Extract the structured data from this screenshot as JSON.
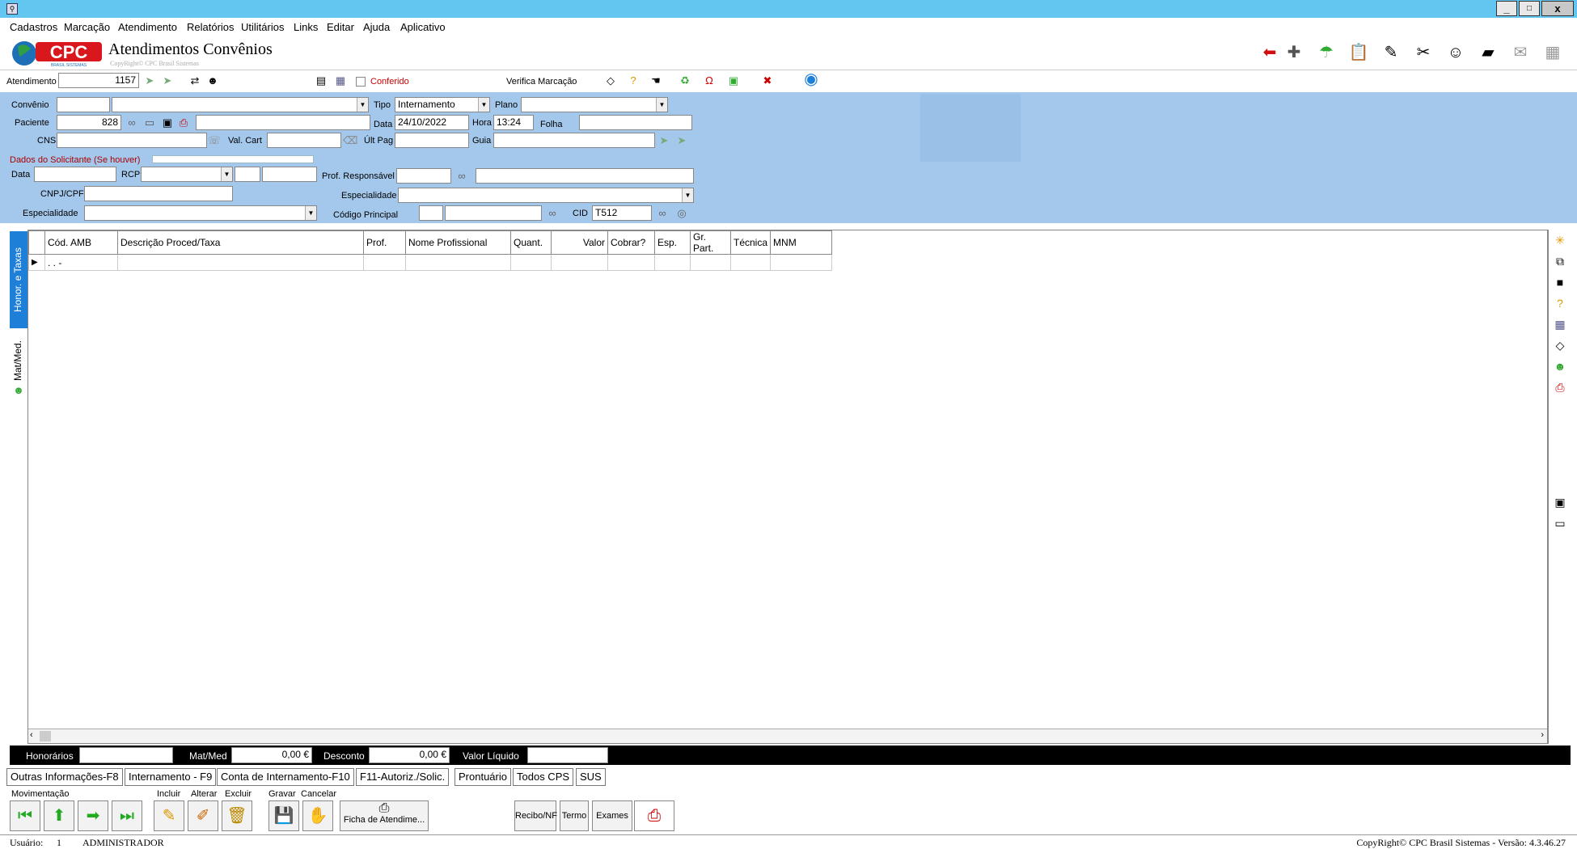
{
  "window": {
    "min": "_",
    "max": "□",
    "close": "x"
  },
  "menu": [
    "Cadastros",
    "Marcação",
    "Atendimento",
    "Relatórios",
    "Utilitários",
    "Links",
    "Editar",
    "Ajuda",
    "Aplicativo"
  ],
  "header": {
    "logo": "CPC",
    "logo_sub": "BRASIL SISTEMAS",
    "title": "Atendimentos Convênios",
    "copyright_small": "CopyRight© CPC Brasil Sistemas"
  },
  "atendimento": {
    "label": "Atendimento",
    "value": "1157",
    "conferido_label": "Conferido",
    "verifica_label": "Verifica Marcação"
  },
  "form": {
    "convenio_label": "Convênio",
    "convenio_code": "",
    "convenio_name": "",
    "tipo_label": "Tipo",
    "tipo_value": "Internamento",
    "plano_label": "Plano",
    "plano_value": "",
    "paciente_label": "Paciente",
    "paciente_code": "828",
    "paciente_name": "",
    "data_label": "Data",
    "data_value": "24/10/2022",
    "hora_label": "Hora",
    "hora_value": "13:24",
    "folha_label": "Folha",
    "folha_value": "",
    "cns_label": "CNS",
    "cns_value": "",
    "valcart_label": "Val. Cart",
    "valcart_value": "",
    "ultpag_label": "Últ Pag",
    "ultpag_value": "",
    "guia_label": "Guia",
    "guia_value": "",
    "solicitante_label": "Dados do Solicitante (Se houver)",
    "sdata_label": "Data",
    "rcp_label": "RCP",
    "cnpj_label": "CNPJ/CPF",
    "esp_label": "Especialidade",
    "profresp_label": "Prof. Responsável",
    "esp2_label": "Especialidade",
    "codprinc_label": "Código Principal",
    "cid_label": "CID",
    "cid_value": "T512"
  },
  "side_tabs": {
    "honor": "Honor. e Taxas",
    "matmed": "Mat/Med."
  },
  "grid": {
    "columns": [
      "",
      "Cód. AMB",
      "Descrição Proced/Taxa",
      "Prof.",
      "Nome Profissional",
      "Quant.",
      "Valor",
      "Cobrar?",
      "Esp.",
      "Gr. Part.",
      "Técnica",
      "MNM"
    ],
    "first_cell": ". . -"
  },
  "totals": {
    "honorarios_label": "Honorários",
    "honorarios_value": "",
    "matmed_label": "Mat/Med",
    "matmed_value": "0,00 €",
    "desconto_label": "Desconto",
    "desconto_value": "0,00 €",
    "liquido_label": "Valor Líquido",
    "liquido_value": ""
  },
  "bottom_tabs": [
    "Outras Informações-F8",
    "Internamento - F9",
    "Conta de Internamento-F10",
    "F11-Autoriz./Solic.",
    "Prontuário",
    "Todos CPS",
    "SUS"
  ],
  "actions": {
    "movimentacao": "Movimentação",
    "incluir": "Incluir",
    "alterar": "Alterar",
    "excluir": "Excluir",
    "gravar": "Gravar",
    "cancelar": "Cancelar",
    "ficha": "Ficha de Atendime...",
    "recibo": "Recibo/NF",
    "termo": "Termo",
    "exames": "Exames"
  },
  "status": {
    "usuario_label": "Usuário:",
    "usuario_id": "1",
    "usuario_name": "ADMINISTRADOR",
    "copyright": "CopyRight© CPC Brasil Sistemas - Versão: 4.3.46.27"
  },
  "colors": {
    "titlebar": "#63c6f0",
    "form_bg": "#a4c8ec",
    "accent_red": "#cc1111"
  }
}
